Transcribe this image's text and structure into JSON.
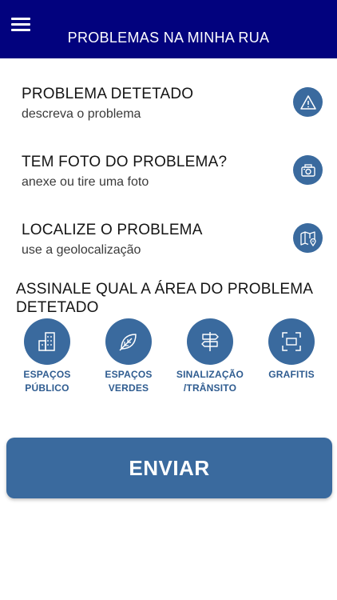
{
  "header": {
    "title": "PROBLEMAS NA MINHA RUA",
    "menu_icon": "hamburger-menu-icon",
    "background_color": "#02027e"
  },
  "rows": [
    {
      "title": "PROBLEMA DETETADO",
      "subtitle": "descreva o problema",
      "icon": "warning-icon"
    },
    {
      "title": "TEM FOTO DO PROBLEMA?",
      "subtitle": "anexe ou tire uma foto",
      "icon": "camera-icon"
    },
    {
      "title": "LOCALIZE O PROBLEMA",
      "subtitle": "use a geolocalização",
      "icon": "map-location-icon"
    }
  ],
  "categories_section": {
    "title": "ASSINALE QUAL A ÁREA DO PROBLEMA DETETADO",
    "items": [
      {
        "label": "ESPAÇOS\nPÚBLICO",
        "icon": "buildings-icon"
      },
      {
        "label": "ESPAÇOS\nVERDES",
        "icon": "leaf-icon"
      },
      {
        "label": "SINALIZAÇÃO\n/TRÂNSITO",
        "icon": "signpost-icon"
      },
      {
        "label": "GRAFITIS",
        "icon": "frame-icon"
      }
    ]
  },
  "submit": {
    "label": "ENVIAR"
  },
  "colors": {
    "accent": "#3a6a9e",
    "label": "#2f5c90"
  }
}
